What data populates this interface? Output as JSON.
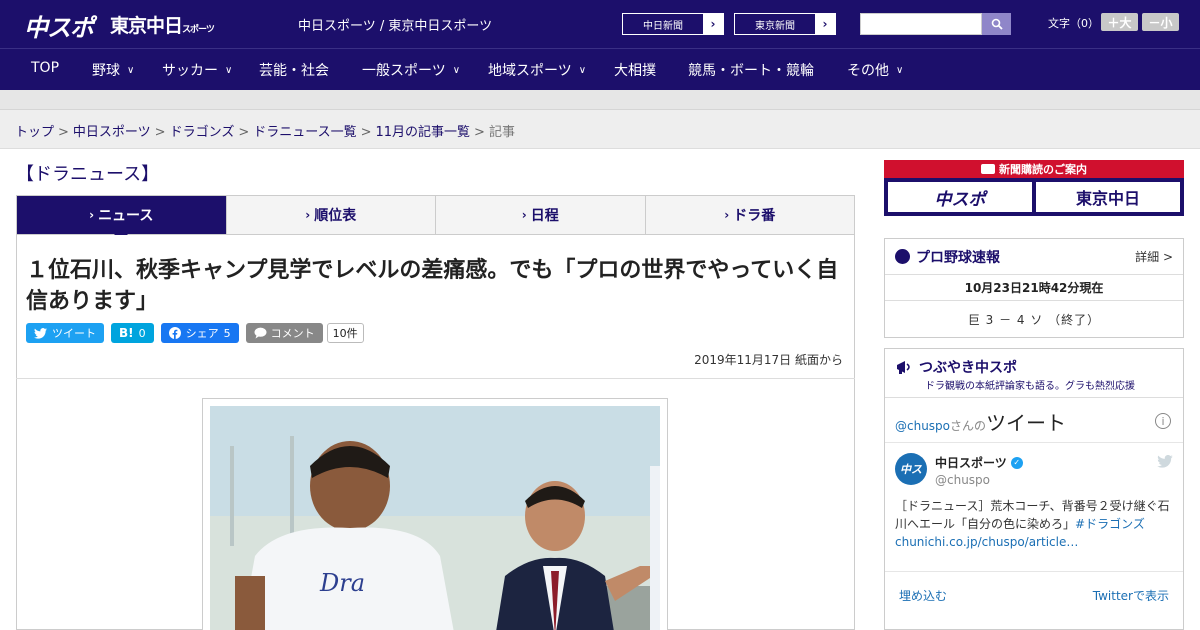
{
  "header": {
    "logo_main": "中スポ",
    "logo_tokyo": "東京中日",
    "logo_tokyo_small": "スポーツ",
    "site_name": "中日スポーツ / 東京中日スポーツ",
    "link_chunichi": "中日新聞",
    "link_tokyo": "東京新聞",
    "search_placeholder": "",
    "font_size_label": "文字（0）",
    "font_larger": "＋大",
    "font_smaller": "－小"
  },
  "nav": {
    "items": [
      {
        "label": "TOP",
        "dropdown": false
      },
      {
        "label": "野球",
        "dropdown": true
      },
      {
        "label": "サッカー",
        "dropdown": true
      },
      {
        "label": "芸能・社会",
        "dropdown": false
      },
      {
        "label": "一般スポーツ",
        "dropdown": true
      },
      {
        "label": "地域スポーツ",
        "dropdown": true
      },
      {
        "label": "大相撲",
        "dropdown": false
      },
      {
        "label": "競馬・ボート・競輪",
        "dropdown": false
      },
      {
        "label": "その他",
        "dropdown": true
      }
    ]
  },
  "breadcrumb": {
    "items": [
      "トップ",
      "中日スポーツ",
      "ドラゴンズ",
      "ドラニュース一覧",
      "11月の記事一覧"
    ],
    "current": "記事"
  },
  "section": {
    "title": "【ドラニュース】",
    "tabs": [
      "ニュース",
      "順位表",
      "日程",
      "ドラ番"
    ]
  },
  "article": {
    "headline": "１位石川、秋季キャンプ見学でレベルの差痛感。でも「プロの世界でやっていく自信あります」",
    "share": {
      "tweet": "ツイート",
      "hatena_icon": "B!",
      "hatena_count": "0",
      "facebook": "シェア",
      "facebook_count": "5",
      "comment": "コメント",
      "comment_count": "10件"
    },
    "date": "2019年11月17日 紙面から"
  },
  "sidebar": {
    "subscribe_title": "新聞購読のご案内",
    "subscribe_logo1": "中スポ",
    "subscribe_logo2": "東京中日",
    "baseball": {
      "title": "プロ野球速報",
      "more": "詳細 >",
      "timestamp": "10月23日21時42分現在",
      "score": "巨 3 － 4 ソ （終了）"
    },
    "twitter": {
      "title": "つぶやき中スポ",
      "subtitle": "ドラ観戦の本紙評論家も語る。グラも熱烈応援",
      "widget_handle_prefix": "@chuspo",
      "widget_handle_suffix": "さんの",
      "widget_title": "ツイート",
      "account_name": "中日スポーツ",
      "account_handle": "@chuspo",
      "tweet_text": "［ドラニュース］荒木コーチ、背番号２受け継ぐ石川へエール「自分の色に染めろ」",
      "tweet_hashtag": "#ドラゴンズ",
      "tweet_link": "chunichi.co.jp/chuspo/article…",
      "embed": "埋め込む",
      "view_on": "Twitterで表示"
    }
  },
  "colors": {
    "brand_navy": "#1c0f6b",
    "subscribe_red": "#d0102e",
    "twitter_blue": "#1da1f2",
    "facebook_blue": "#1877f2",
    "hatena_blue": "#00a4de"
  }
}
